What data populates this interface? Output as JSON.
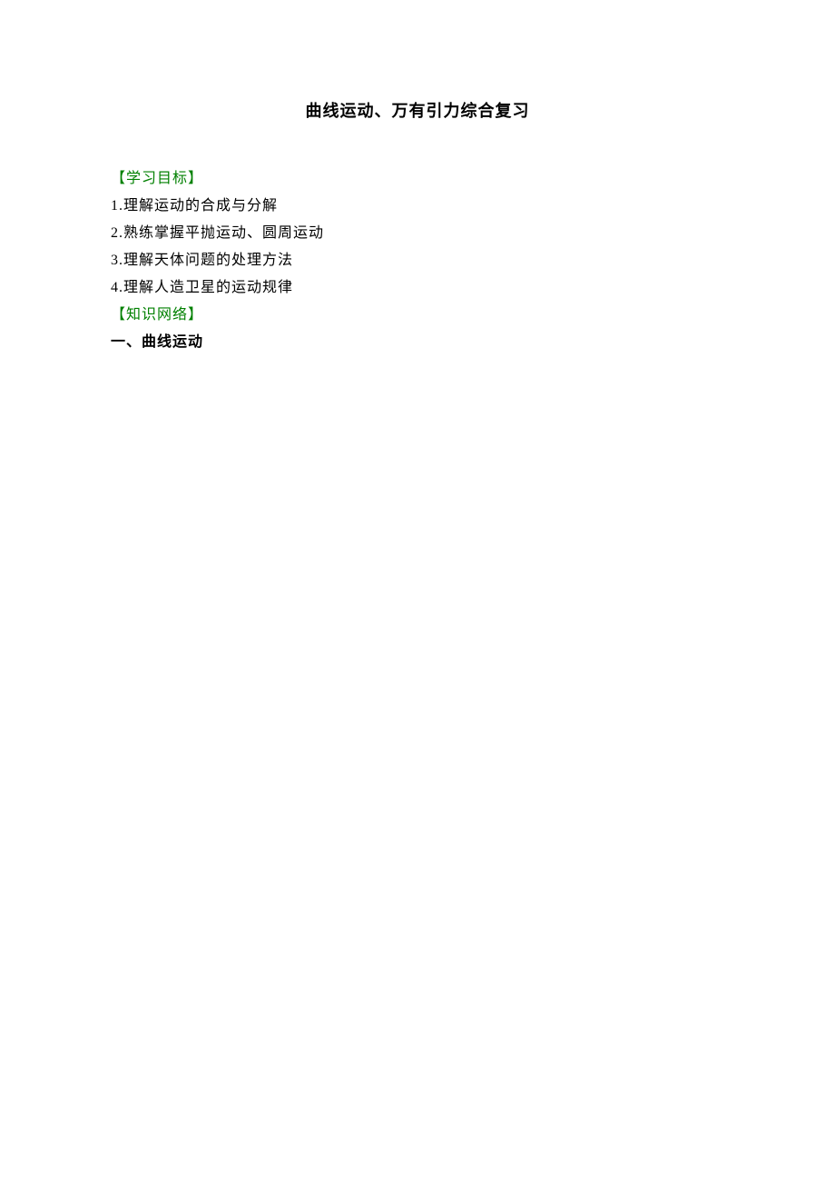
{
  "title": "曲线运动、万有引力综合复习",
  "sections": {
    "learning_objectives": {
      "header": "【学习目标】",
      "items": [
        "1.理解运动的合成与分解",
        "2.熟练掌握平抛运动、圆周运动",
        "3.理解天体问题的处理方法",
        "4.理解人造卫星的运动规律"
      ]
    },
    "knowledge_network": {
      "header": "【知识网络】",
      "subsection": "一、曲线运动"
    }
  }
}
